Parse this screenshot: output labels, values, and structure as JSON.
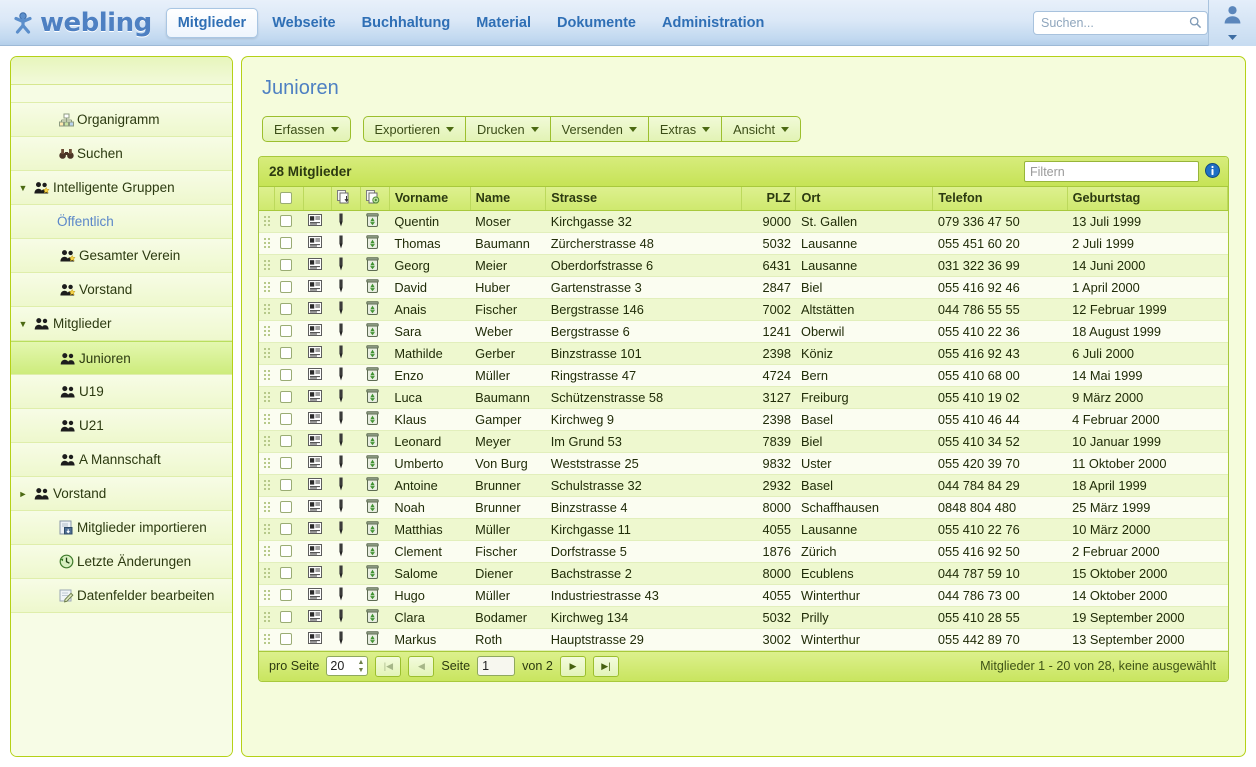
{
  "brand": {
    "name": "webling",
    "logo_icon": "person-star-icon"
  },
  "nav": {
    "items": [
      {
        "label": "Mitglieder",
        "active": true
      },
      {
        "label": "Webseite",
        "active": false
      },
      {
        "label": "Buchhaltung",
        "active": false
      },
      {
        "label": "Material",
        "active": false
      },
      {
        "label": "Dokumente",
        "active": false
      },
      {
        "label": "Administration",
        "active": false
      }
    ]
  },
  "search": {
    "placeholder": "Suchen...",
    "value": "",
    "icon": "search-icon"
  },
  "user_menu": {
    "icon": "user-avatar-icon",
    "caret": "chevron-down-icon"
  },
  "sidebar": {
    "items": [
      {
        "label": "Organigramm",
        "icon": "organigram-icon",
        "indent": 1,
        "arrow": "",
        "state": ""
      },
      {
        "label": "Suchen",
        "icon": "binoculars-icon",
        "indent": 1,
        "arrow": "",
        "state": ""
      },
      {
        "label": "Intelligente Gruppen",
        "icon": "group-star-icon",
        "indent": 0,
        "arrow": "expanded",
        "state": ""
      },
      {
        "label": "Öffentlich",
        "icon": "",
        "indent": 2,
        "arrow": "",
        "state": "link"
      },
      {
        "label": "Gesamter Verein",
        "icon": "group-star-icon",
        "indent": 2,
        "arrow": "",
        "state": ""
      },
      {
        "label": "Vorstand",
        "icon": "group-star-icon",
        "indent": 2,
        "arrow": "",
        "state": ""
      },
      {
        "label": "Mitglieder",
        "icon": "group-icon",
        "indent": 0,
        "arrow": "expanded",
        "state": ""
      },
      {
        "label": "Junioren",
        "icon": "group-icon",
        "indent": 2,
        "arrow": "",
        "state": "selected"
      },
      {
        "label": "U19",
        "icon": "group-icon",
        "indent": 2,
        "arrow": "",
        "state": ""
      },
      {
        "label": "U21",
        "icon": "group-icon",
        "indent": 2,
        "arrow": "",
        "state": ""
      },
      {
        "label": "A Mannschaft",
        "icon": "group-icon",
        "indent": 2,
        "arrow": "",
        "state": ""
      },
      {
        "label": "Vorstand",
        "icon": "group-icon",
        "indent": 0,
        "arrow": "collapsed",
        "state": ""
      },
      {
        "label": "Mitglieder importieren",
        "icon": "import-icon",
        "indent": 1,
        "arrow": "",
        "state": ""
      },
      {
        "label": "Letzte Änderungen",
        "icon": "clock-icon",
        "indent": 1,
        "arrow": "",
        "state": ""
      },
      {
        "label": "Datenfelder bearbeiten",
        "icon": "edit-fields-icon",
        "indent": 1,
        "arrow": "",
        "state": ""
      }
    ]
  },
  "main": {
    "title": "Junioren",
    "toolbar": {
      "primary": {
        "label": "Erfassen",
        "caret": "caret-down-icon"
      },
      "group": [
        {
          "label": "Exportieren",
          "caret": "caret-down-icon"
        },
        {
          "label": "Drucken",
          "caret": "caret-down-icon"
        },
        {
          "label": "Versenden",
          "caret": "caret-down-icon"
        },
        {
          "label": "Extras",
          "caret": "caret-down-icon"
        },
        {
          "label": "Ansicht",
          "caret": "caret-down-icon"
        }
      ]
    },
    "table": {
      "count_label": "28 Mitglieder",
      "filter": {
        "placeholder": "Filtern",
        "value": ""
      },
      "info_icon": "info-icon",
      "select_all_icon": "checkbox-icon",
      "col_icon_1": "copy-contact-icon",
      "col_icon_2": "copy-delete-icon",
      "headers": [
        "Vorname",
        "Name",
        "Strasse",
        "PLZ",
        "Ort",
        "Telefon",
        "Geburtstag"
      ],
      "rows": [
        {
          "vorname": "Quentin",
          "name": "Moser",
          "strasse": "Kirchgasse 32",
          "plz": "9000",
          "ort": "St. Gallen",
          "telefon": "079 336 47 50",
          "geburtstag": "13 Juli 1999"
        },
        {
          "vorname": "Thomas",
          "name": "Baumann",
          "strasse": "Zürcherstrasse 48",
          "plz": "5032",
          "ort": "Lausanne",
          "telefon": "055 451 60 20",
          "geburtstag": "2 Juli 1999"
        },
        {
          "vorname": "Georg",
          "name": "Meier",
          "strasse": "Oberdorfstrasse 6",
          "plz": "6431",
          "ort": "Lausanne",
          "telefon": "031 322 36 99",
          "geburtstag": "14 Juni 2000"
        },
        {
          "vorname": "David",
          "name": "Huber",
          "strasse": "Gartenstrasse 3",
          "plz": "2847",
          "ort": "Biel",
          "telefon": "055 416 92 46",
          "geburtstag": "1 April 2000"
        },
        {
          "vorname": "Anais",
          "name": "Fischer",
          "strasse": "Bergstrasse 146",
          "plz": "7002",
          "ort": "Altstätten",
          "telefon": "044 786 55 55",
          "geburtstag": "12 Februar 1999"
        },
        {
          "vorname": "Sara",
          "name": "Weber",
          "strasse": "Bergstrasse 6",
          "plz": "1241",
          "ort": "Oberwil",
          "telefon": "055 410 22 36",
          "geburtstag": "18 August 1999"
        },
        {
          "vorname": "Mathilde",
          "name": "Gerber",
          "strasse": "Binzstrasse 101",
          "plz": "2398",
          "ort": "Köniz",
          "telefon": "055 416 92 43",
          "geburtstag": "6 Juli 2000"
        },
        {
          "vorname": "Enzo",
          "name": "Müller",
          "strasse": "Ringstrasse 47",
          "plz": "4724",
          "ort": "Bern",
          "telefon": "055 410 68 00",
          "geburtstag": "14 Mai 1999"
        },
        {
          "vorname": "Luca",
          "name": "Baumann",
          "strasse": "Schützenstrasse 58",
          "plz": "3127",
          "ort": "Freiburg",
          "telefon": "055 410 19 02",
          "geburtstag": "9 März 2000"
        },
        {
          "vorname": "Klaus",
          "name": "Gamper",
          "strasse": "Kirchweg 9",
          "plz": "2398",
          "ort": "Basel",
          "telefon": "055 410 46 44",
          "geburtstag": "4 Februar 2000"
        },
        {
          "vorname": "Leonard",
          "name": "Meyer",
          "strasse": "Im Grund 53",
          "plz": "7839",
          "ort": "Biel",
          "telefon": "055 410 34 52",
          "geburtstag": "10 Januar 1999"
        },
        {
          "vorname": "Umberto",
          "name": "Von Burg",
          "strasse": "Weststrasse 25",
          "plz": "9832",
          "ort": "Uster",
          "telefon": "055 420 39 70",
          "geburtstag": "11 Oktober 2000"
        },
        {
          "vorname": "Antoine",
          "name": "Brunner",
          "strasse": "Schulstrasse 32",
          "plz": "2932",
          "ort": "Basel",
          "telefon": "044 784 84 29",
          "geburtstag": "18 April 1999"
        },
        {
          "vorname": "Noah",
          "name": "Brunner",
          "strasse": "Binzstrasse 4",
          "plz": "8000",
          "ort": "Schaffhausen",
          "telefon": "0848 804 480",
          "geburtstag": "25 März 1999"
        },
        {
          "vorname": "Matthias",
          "name": "Müller",
          "strasse": "Kirchgasse 11",
          "plz": "4055",
          "ort": "Lausanne",
          "telefon": "055 410 22 76",
          "geburtstag": "10 März 2000"
        },
        {
          "vorname": "Clement",
          "name": "Fischer",
          "strasse": "Dorfstrasse 5",
          "plz": "1876",
          "ort": "Zürich",
          "telefon": "055 416 92 50",
          "geburtstag": "2 Februar 2000"
        },
        {
          "vorname": "Salome",
          "name": "Diener",
          "strasse": "Bachstrasse 2",
          "plz": "8000",
          "ort": "Ecublens",
          "telefon": "044 787 59 10",
          "geburtstag": "15 Oktober 2000"
        },
        {
          "vorname": "Hugo",
          "name": "Müller",
          "strasse": "Industriestrasse 43",
          "plz": "4055",
          "ort": "Winterthur",
          "telefon": "044 786 73 00",
          "geburtstag": "14 Oktober 2000"
        },
        {
          "vorname": "Clara",
          "name": "Bodamer",
          "strasse": "Kirchweg 134",
          "plz": "5032",
          "ort": "Prilly",
          "telefon": "055 410 28 55",
          "geburtstag": "19 September 2000"
        },
        {
          "vorname": "Markus",
          "name": "Roth",
          "strasse": "Hauptstrasse 29",
          "plz": "3002",
          "ort": "Winterthur",
          "telefon": "055 442 89 70",
          "geburtstag": "13 September 2000"
        }
      ]
    },
    "footer": {
      "per_page_label": "pro Seite",
      "per_page_value": "20",
      "first_icon": "first-page-icon",
      "prev_icon": "prev-page-icon",
      "page_label": "Seite",
      "page_value": "1",
      "of_label": "von 2",
      "next_icon": "next-page-icon",
      "last_icon": "last-page-icon",
      "status": "Mitglieder 1 - 20 von 28, keine ausgewählt"
    }
  },
  "colors": {
    "brand_blue": "#4e80c2",
    "nav_blue": "#2f6fb5",
    "accent_green": "#b5d117",
    "panel_bg": "#f5fcdc",
    "table_header": "#cfe96e",
    "row_odd": "#eef8cf",
    "row_even": "#fbfdf1"
  }
}
